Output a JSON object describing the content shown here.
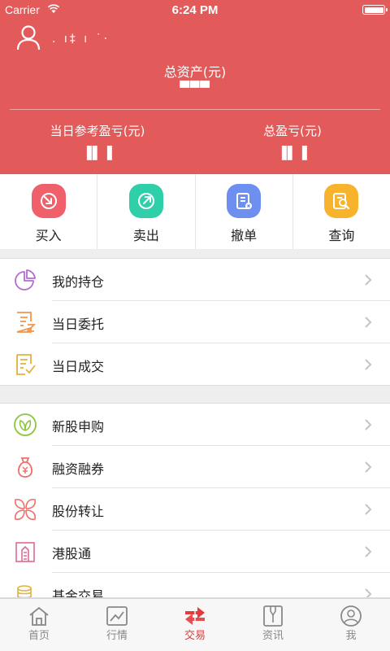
{
  "status_bar": {
    "carrier": "Carrier",
    "time": "6:24 PM"
  },
  "account": {
    "username": ". ı‡ ı ˙·",
    "total_assets_label": "总资产(元)",
    "total_assets_value": "▀▀▀",
    "daily_pl_label": "当日参考盈亏(元)",
    "daily_pl_value": "▐▌▐",
    "total_pl_label": "总盈亏(元)",
    "total_pl_value": "▐▌▐"
  },
  "actions": [
    {
      "label": "买入",
      "icon": "buy-icon",
      "color": "#f0606a"
    },
    {
      "label": "卖出",
      "icon": "sell-icon",
      "color": "#2fcfa9"
    },
    {
      "label": "撤单",
      "icon": "cancel-order-icon",
      "color": "#6c8ff0"
    },
    {
      "label": "查询",
      "icon": "query-icon",
      "color": "#f7b32b"
    }
  ],
  "menu_group1": [
    {
      "label": "我的持仓",
      "icon": "pie-chart-icon"
    },
    {
      "label": "当日委托",
      "icon": "order-list-icon"
    },
    {
      "label": "当日成交",
      "icon": "deal-list-icon"
    }
  ],
  "menu_group2": [
    {
      "label": "新股申购",
      "icon": "leaf-icon"
    },
    {
      "label": "融资融券",
      "icon": "money-bag-icon"
    },
    {
      "label": "股份转让",
      "icon": "petal-icon"
    },
    {
      "label": "港股通",
      "icon": "building-icon"
    },
    {
      "label": "基金交易",
      "icon": "coins-icon"
    }
  ],
  "tabs": [
    {
      "label": "首页",
      "icon": "home-icon"
    },
    {
      "label": "行情",
      "icon": "chart-icon"
    },
    {
      "label": "交易",
      "icon": "trade-icon",
      "active": true
    },
    {
      "label": "资讯",
      "icon": "news-icon"
    },
    {
      "label": "我",
      "icon": "profile-icon"
    }
  ],
  "colors": {
    "header": "#e25b5a",
    "active_tab": "#e23b3b"
  }
}
